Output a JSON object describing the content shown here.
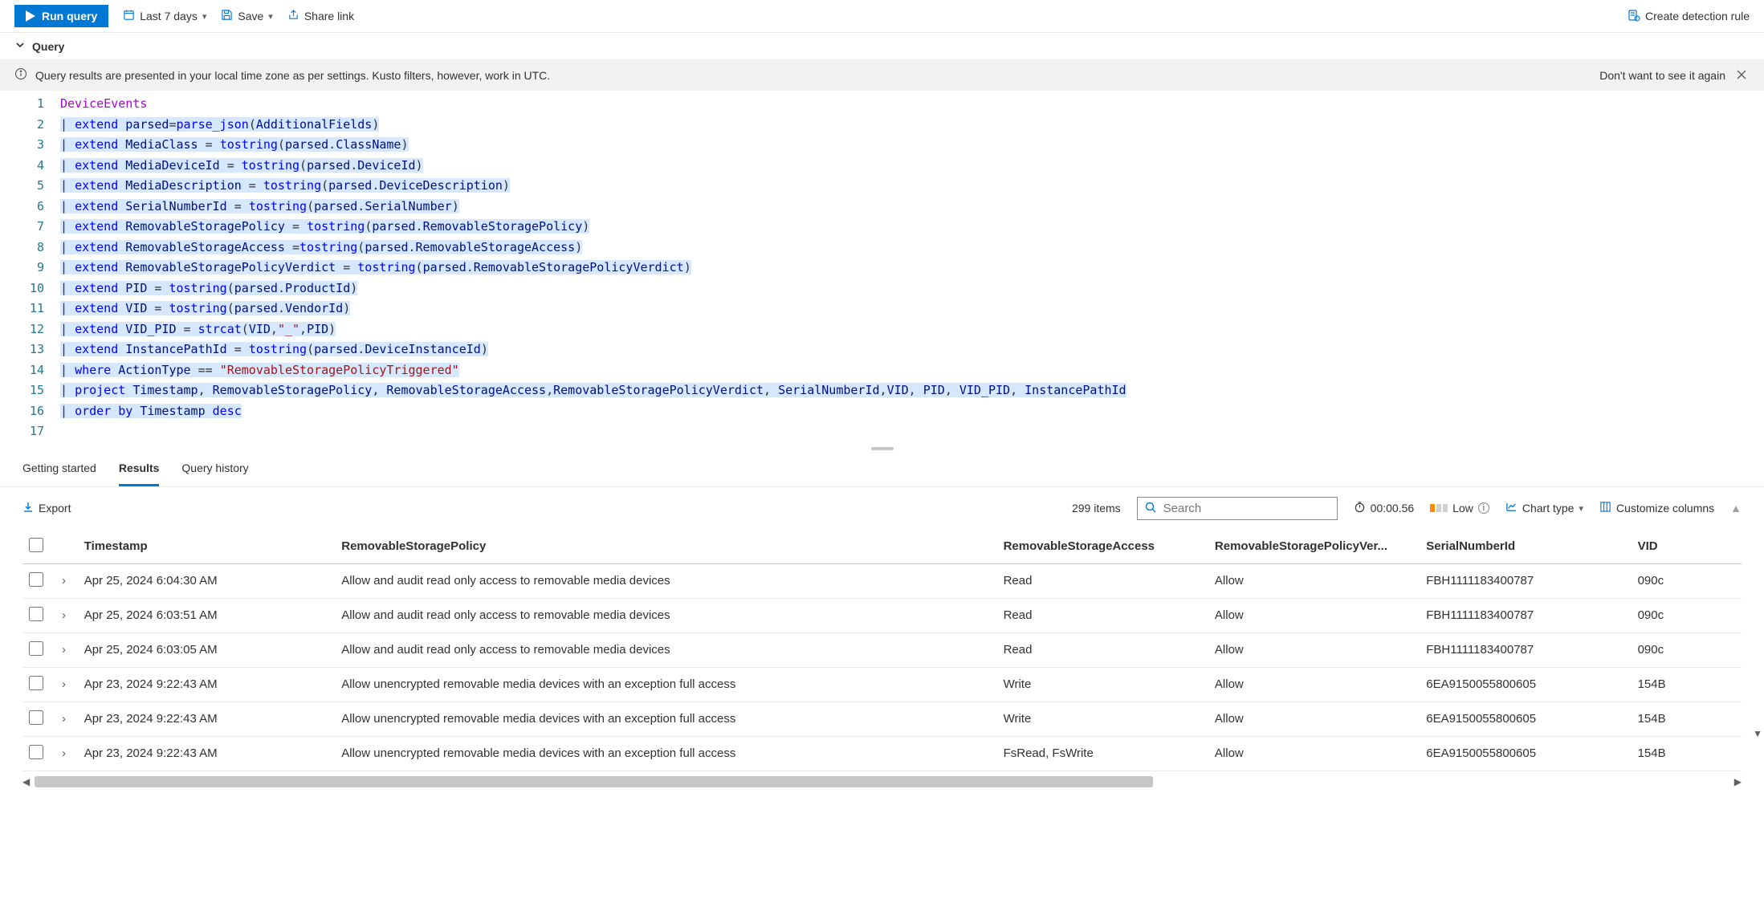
{
  "toolbar": {
    "run": "Run query",
    "time_range": "Last 7 days",
    "save": "Save",
    "share": "Share link",
    "create_rule": "Create detection rule"
  },
  "query_section_label": "Query",
  "info_bar": {
    "message": "Query results are presented in your local time zone as per settings. Kusto filters, however, work in UTC.",
    "dismiss": "Don't want to see it again"
  },
  "editor": {
    "lines": [
      {
        "n": 1,
        "html": "<span class='kw-ent'>DeviceEvents</span>"
      },
      {
        "n": 2,
        "html": "<span class='sel'>| <span class='kw-fn'>extend</span> <span class='kw-field'>parsed</span>=<span class='kw-fn'>parse_json</span>(<span class='kw-field'>AdditionalFields</span>)</span>"
      },
      {
        "n": 3,
        "html": "<span class='sel'>| <span class='kw-fn'>extend</span> <span class='kw-field'>MediaClass</span> = <span class='kw-fn'>tostring</span>(<span class='kw-field'>parsed</span>.<span class='kw-field'>ClassName</span>)</span>"
      },
      {
        "n": 4,
        "html": "<span class='sel'>| <span class='kw-fn'>extend</span> <span class='kw-field'>MediaDeviceId</span> = <span class='kw-fn'>tostring</span>(<span class='kw-field'>parsed</span>.<span class='kw-field'>DeviceId</span>)</span>"
      },
      {
        "n": 5,
        "html": "<span class='sel'>| <span class='kw-fn'>extend</span> <span class='kw-field'>MediaDescription</span> = <span class='kw-fn'>tostring</span>(<span class='kw-field'>parsed</span>.<span class='kw-field'>DeviceDescription</span>)</span>"
      },
      {
        "n": 6,
        "html": "<span class='sel'>| <span class='kw-fn'>extend</span> <span class='kw-field'>SerialNumberId</span> = <span class='kw-fn'>tostring</span>(<span class='kw-field'>parsed</span>.<span class='kw-field'>SerialNumber</span>)</span>"
      },
      {
        "n": 7,
        "html": "<span class='sel'>| <span class='kw-fn'>extend</span> <span class='kw-field'>RemovableStoragePolicy</span> = <span class='kw-fn'>tostring</span>(<span class='kw-field'>parsed</span>.<span class='kw-field'>RemovableStoragePolicy</span>)</span>"
      },
      {
        "n": 8,
        "html": "<span class='sel'>| <span class='kw-fn'>extend</span> <span class='kw-field'>RemovableStorageAccess</span> =<span class='kw-fn'>tostring</span>(<span class='kw-field'>parsed</span>.<span class='kw-field'>RemovableStorageAccess</span>)</span>"
      },
      {
        "n": 9,
        "html": "<span class='sel'>| <span class='kw-fn'>extend</span> <span class='kw-field'>RemovableStoragePolicyVerdict</span> = <span class='kw-fn'>tostring</span>(<span class='kw-field'>parsed</span>.<span class='kw-field'>RemovableStoragePolicyVerdict</span>)</span>"
      },
      {
        "n": 10,
        "html": "<span class='sel'>| <span class='kw-fn'>extend</span> <span class='kw-field'>PID</span> = <span class='kw-fn'>tostring</span>(<span class='kw-field'>parsed</span>.<span class='kw-field'>ProductId</span>)</span>"
      },
      {
        "n": 11,
        "html": "<span class='sel'>| <span class='kw-fn'>extend</span> <span class='kw-field'>VID</span> = <span class='kw-fn'>tostring</span>(<span class='kw-field'>parsed</span>.<span class='kw-field'>VendorId</span>)</span>"
      },
      {
        "n": 12,
        "html": "<span class='sel'>| <span class='kw-fn'>extend</span> <span class='kw-field'>VID_PID</span> = <span class='kw-fn'>strcat</span>(<span class='kw-field'>VID</span>,<span class='kw-str'>&quot;_&quot;</span>,<span class='kw-field'>PID</span>)</span>"
      },
      {
        "n": 13,
        "html": "<span class='sel'>| <span class='kw-fn'>extend</span> <span class='kw-field'>InstancePathId</span> = <span class='kw-fn'>tostring</span>(<span class='kw-field'>parsed</span>.<span class='kw-field'>DeviceInstanceId</span>)</span>"
      },
      {
        "n": 14,
        "html": "<span class='sel'>| <span class='kw-fn'>where</span> <span class='kw-field'>ActionType</span> == <span class='kw-str'>&quot;RemovableStoragePolicyTriggered&quot;</span></span>"
      },
      {
        "n": 15,
        "html": "<span class='sel'>| <span class='kw-fn'>project</span> <span class='kw-field'>Timestamp</span>, <span class='kw-field'>RemovableStoragePolicy</span>, <span class='kw-field'>RemovableStorageAccess</span>,<span class='kw-field'>RemovableStoragePolicyVerdict</span>, <span class='kw-field'>SerialNumberId</span>,<span class='kw-field'>VID</span>, <span class='kw-field'>PID</span>, <span class='kw-field'>VID_PID</span>, <span class='kw-field'>InstancePathId</span></span>"
      },
      {
        "n": 16,
        "html": "<span class='sel'>| <span class='kw-fn'>order by</span> <span class='kw-field'>Timestamp</span> <span class='kw-fn'>desc</span></span>"
      },
      {
        "n": 17,
        "html": ""
      }
    ]
  },
  "tabs": {
    "getting_started": "Getting started",
    "results": "Results",
    "query_history": "Query history"
  },
  "results": {
    "export": "Export",
    "item_count": "299 items",
    "search_placeholder": "Search",
    "elapsed": "00:00.56",
    "severity": "Low",
    "chart_type": "Chart type",
    "customize": "Customize columns",
    "columns": {
      "timestamp": "Timestamp",
      "policy": "RemovableStoragePolicy",
      "access": "RemovableStorageAccess",
      "verdict": "RemovableStoragePolicyVer...",
      "serial": "SerialNumberId",
      "vid": "VID"
    },
    "rows": [
      {
        "ts": "Apr 25, 2024 6:04:30 AM",
        "policy": "Allow and audit read only access to removable media devices",
        "access": "Read",
        "verdict": "Allow",
        "serial": "FBH1111183400787",
        "vid": "090c"
      },
      {
        "ts": "Apr 25, 2024 6:03:51 AM",
        "policy": "Allow and audit read only access to removable media devices",
        "access": "Read",
        "verdict": "Allow",
        "serial": "FBH1111183400787",
        "vid": "090c"
      },
      {
        "ts": "Apr 25, 2024 6:03:05 AM",
        "policy": "Allow and audit read only access to removable media devices",
        "access": "Read",
        "verdict": "Allow",
        "serial": "FBH1111183400787",
        "vid": "090c"
      },
      {
        "ts": "Apr 23, 2024 9:22:43 AM",
        "policy": "Allow unencrypted removable media devices with an exception full access",
        "access": "Write",
        "verdict": "Allow",
        "serial": "6EA9150055800605",
        "vid": "154B"
      },
      {
        "ts": "Apr 23, 2024 9:22:43 AM",
        "policy": "Allow unencrypted removable media devices with an exception full access",
        "access": "Write",
        "verdict": "Allow",
        "serial": "6EA9150055800605",
        "vid": "154B"
      },
      {
        "ts": "Apr 23, 2024 9:22:43 AM",
        "policy": "Allow unencrypted removable media devices with an exception full access",
        "access": "FsRead, FsWrite",
        "verdict": "Allow",
        "serial": "6EA9150055800605",
        "vid": "154B"
      }
    ]
  }
}
